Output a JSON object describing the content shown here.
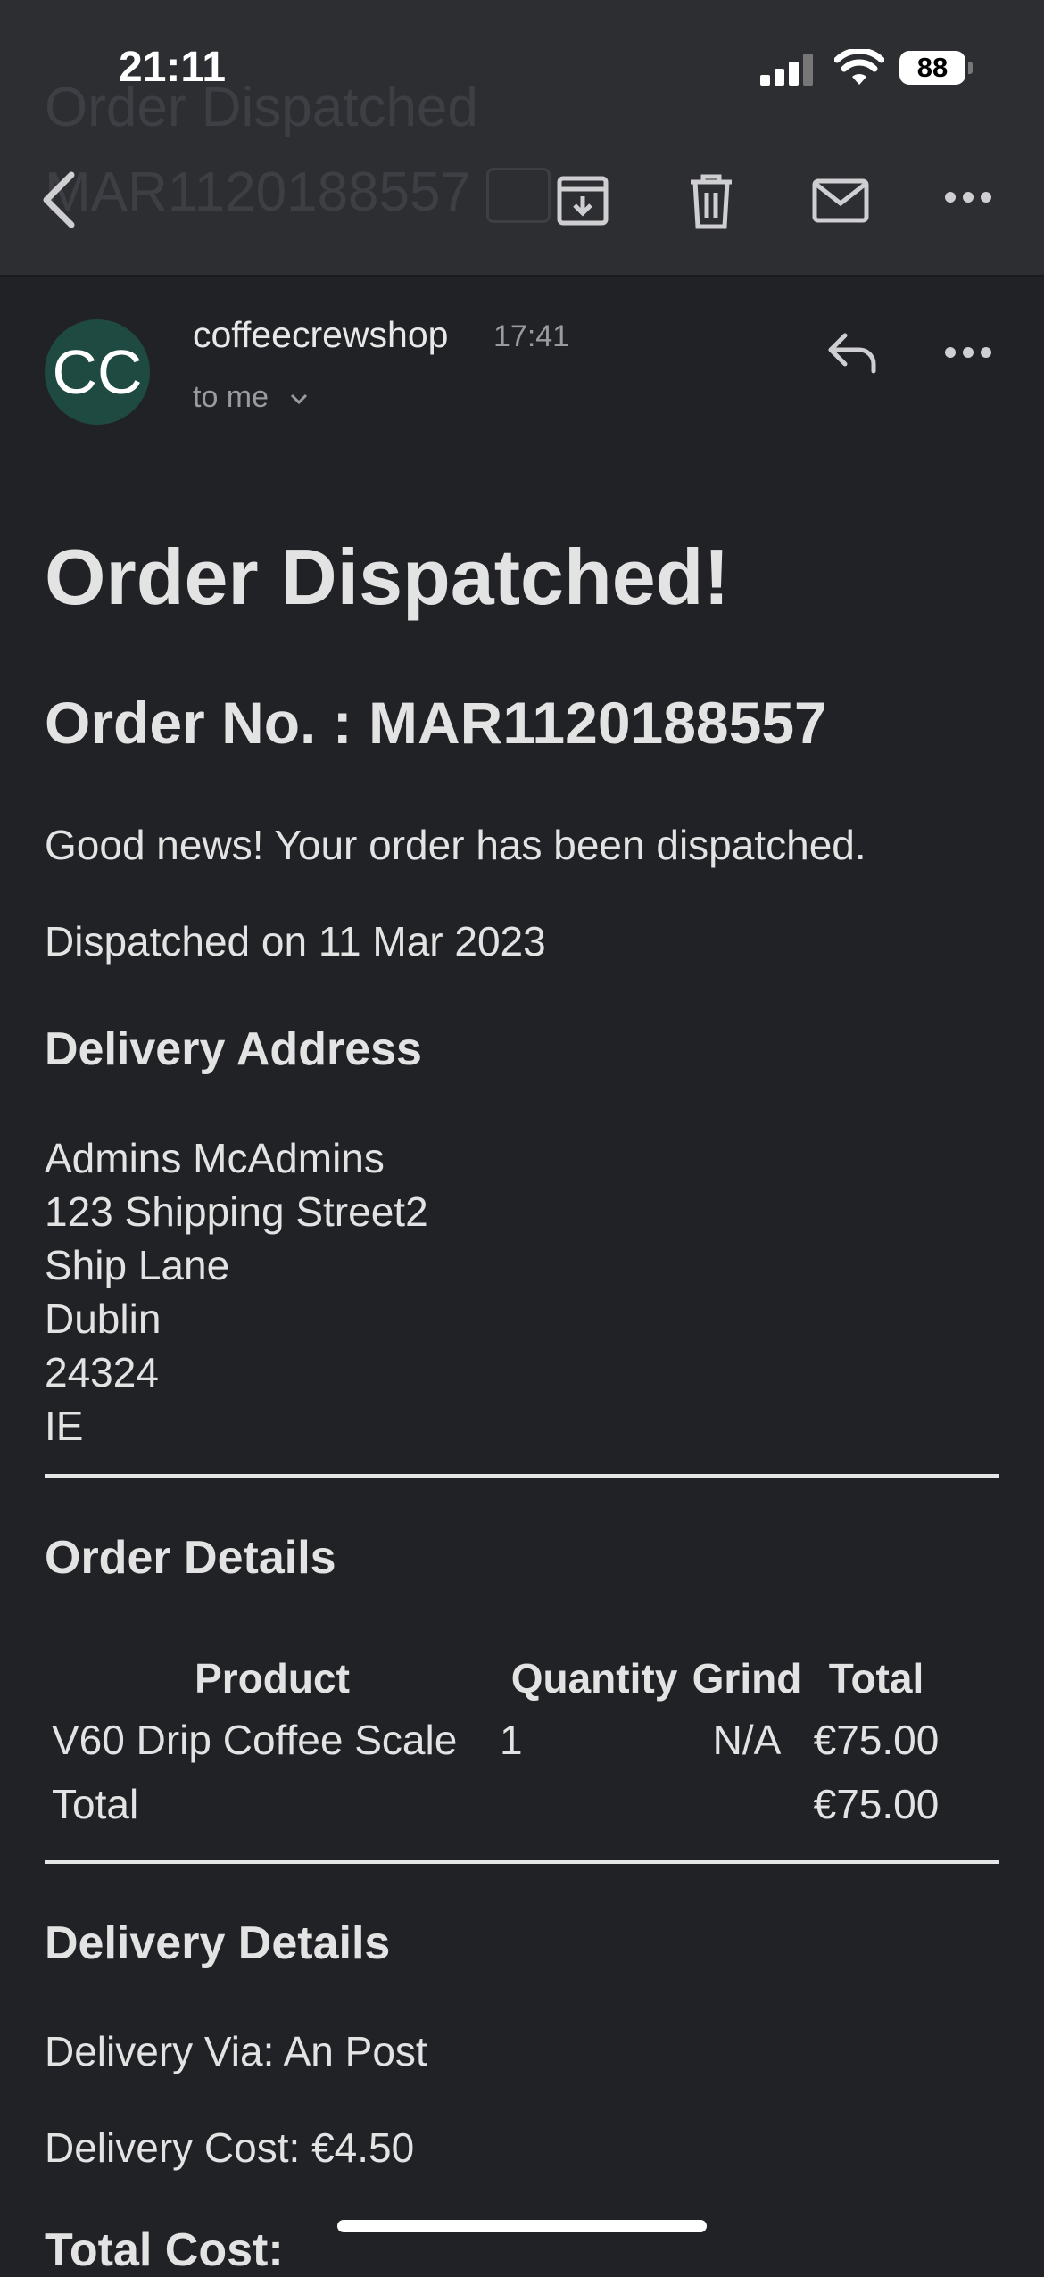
{
  "status_bar": {
    "time": "21:11",
    "battery": "88"
  },
  "top_bar": {
    "ghost_title_line1": "Order Dispatched",
    "ghost_title_line2": "MAR1120188557"
  },
  "email": {
    "avatar_initials": "CC",
    "sender": "coffeecrewshop",
    "time": "17:41",
    "recipient": "to me",
    "title": "Order Dispatched!",
    "order_number": "Order No. : MAR1120188557",
    "intro": "Good news! Your order has been dispatched.",
    "dispatched_on": "Dispatched on 11 Mar 2023",
    "delivery_address": {
      "heading": "Delivery Address",
      "lines": [
        "Admins McAdmins",
        "123 Shipping Street2",
        "Ship Lane",
        "Dublin",
        "24324",
        "IE"
      ]
    },
    "order_details": {
      "heading": "Order Details",
      "columns": [
        "Product",
        "Quantity",
        "Grind",
        "Total"
      ],
      "rows": [
        {
          "product": "V60 Drip Coffee Scale",
          "quantity": "1",
          "grind": "N/A",
          "total": "€75.00"
        }
      ],
      "total_label": "Total",
      "total_value": "€75.00"
    },
    "delivery_details": {
      "heading": "Delivery Details",
      "via": "Delivery Via: An Post",
      "cost": "Delivery Cost: €4.50"
    },
    "total_cost_label": "Total Cost:"
  }
}
